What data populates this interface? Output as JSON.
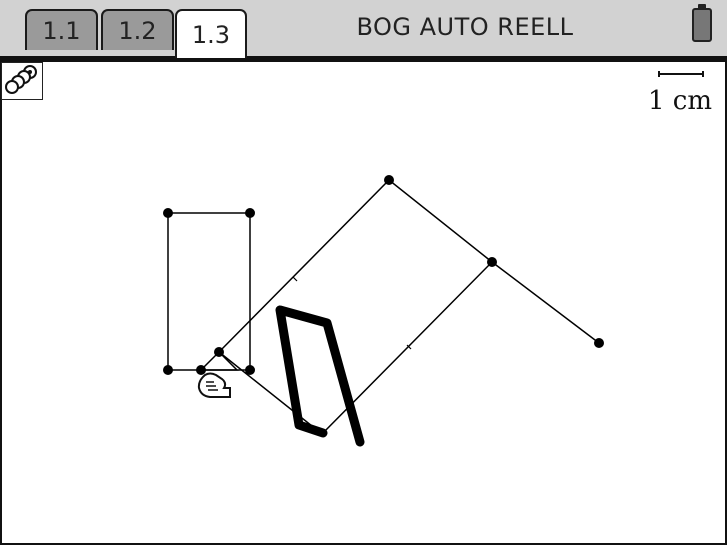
{
  "tabs": [
    {
      "label": "1.1",
      "active": false
    },
    {
      "label": "1.2",
      "active": false
    },
    {
      "label": "1.3",
      "active": true
    }
  ],
  "document_title": "BOG AUTO REELL",
  "scale": {
    "label": "1 cm"
  },
  "icons": {
    "battery": "battery-icon",
    "tool": "geometry-tool-icon",
    "cursor": "grab-hand-cursor-icon"
  },
  "colors": {
    "tab_active_bg": "#ffffff",
    "tab_inactive_bg": "#9a9a9a",
    "topbar_bg": "#d2d2d2",
    "ink": "#000000"
  }
}
